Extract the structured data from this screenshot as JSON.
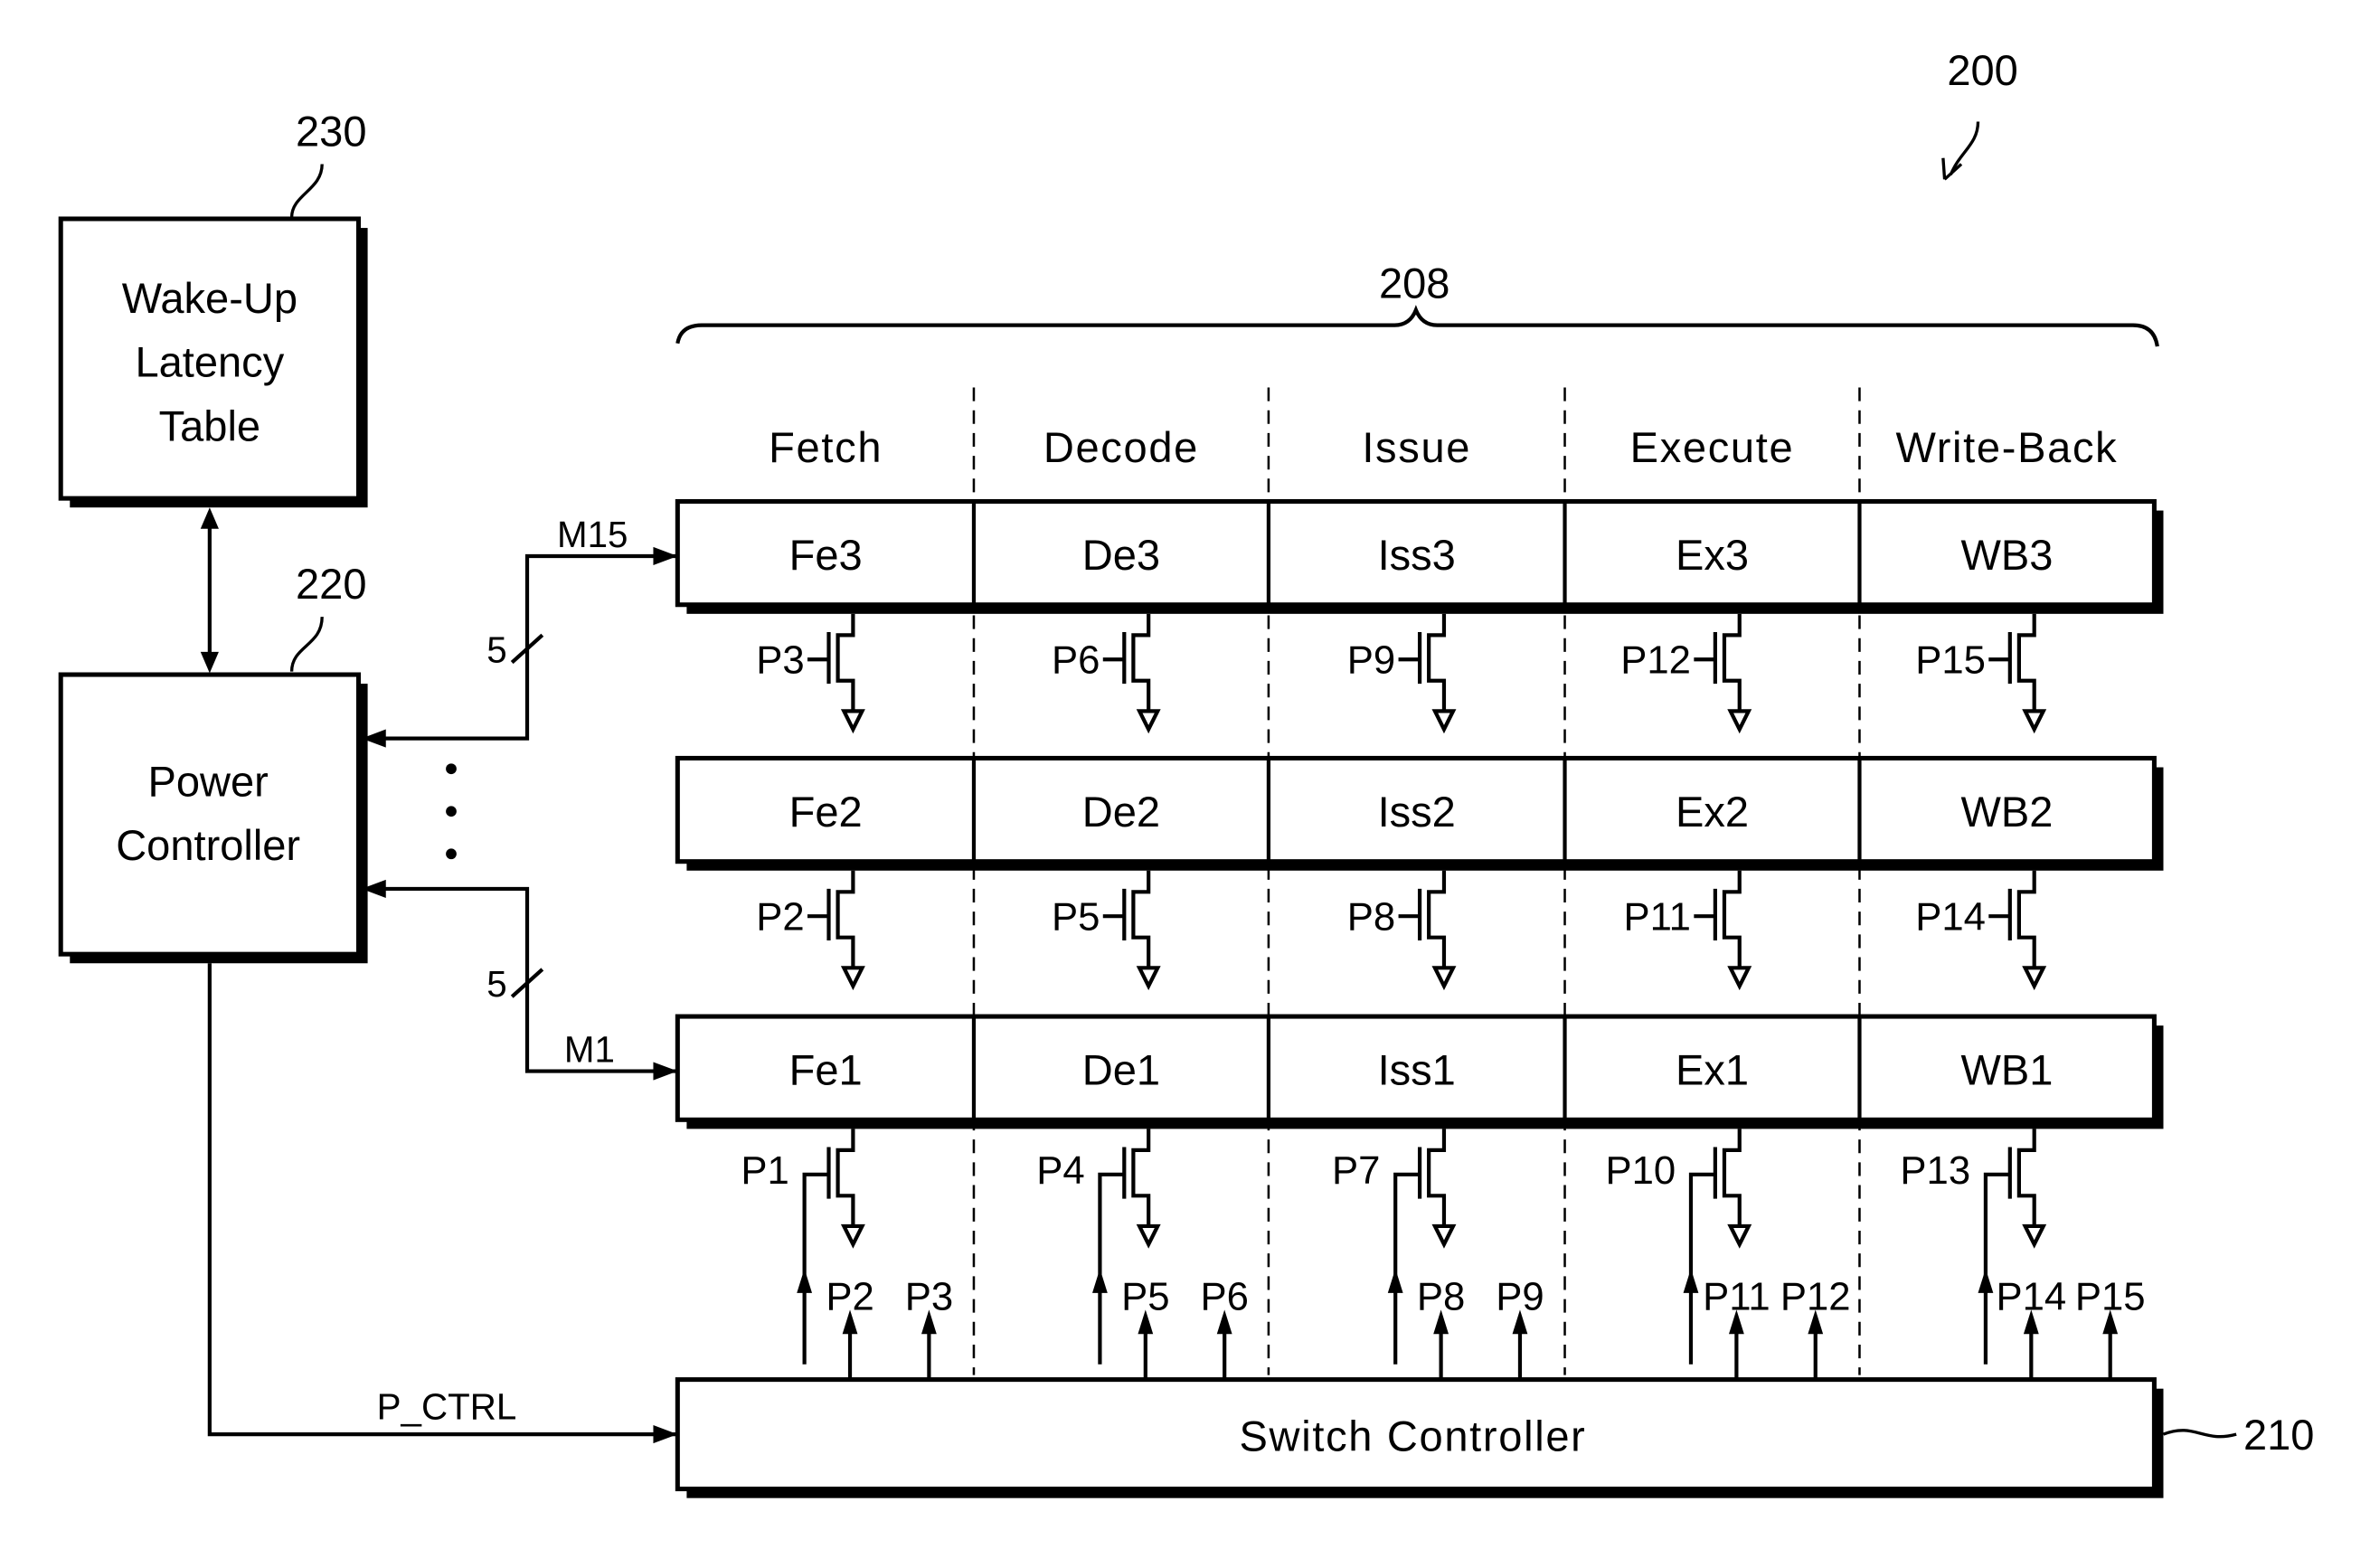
{
  "figure": {
    "ref_system": "200",
    "ref_pipeline": "208",
    "ref_switch_controller": "210",
    "ref_power_controller": "220",
    "ref_latency_table": "230"
  },
  "blocks": {
    "latency_table": [
      "Wake-Up",
      "Latency",
      "Table"
    ],
    "power_controller": [
      "Power",
      "Controller"
    ],
    "switch_controller": "Switch Controller"
  },
  "stages": [
    "Fetch",
    "Decode",
    "Issue",
    "Execute",
    "Write-Back"
  ],
  "pipeline_rows": [
    {
      "id": "row3",
      "cells": [
        "Fe3",
        "De3",
        "Iss3",
        "Ex3",
        "WB3"
      ],
      "gates": [
        "P3",
        "P6",
        "P9",
        "P12",
        "P15"
      ]
    },
    {
      "id": "row2",
      "cells": [
        "Fe2",
        "De2",
        "Iss2",
        "Ex2",
        "WB2"
      ],
      "gates": [
        "P2",
        "P5",
        "P8",
        "P11",
        "P14"
      ]
    },
    {
      "id": "row1",
      "cells": [
        "Fe1",
        "De1",
        "Iss1",
        "Ex1",
        "WB1"
      ],
      "gates": [
        "P1",
        "P4",
        "P7",
        "P10",
        "P13"
      ]
    }
  ],
  "switch_outputs": [
    [
      "P2",
      "P3"
    ],
    [
      "P5",
      "P6"
    ],
    [
      "P8",
      "P9"
    ],
    [
      "P11",
      "P12"
    ],
    [
      "P14",
      "P15"
    ]
  ],
  "signals": {
    "m15": "M15",
    "m1": "M1",
    "bus_width_top": "5",
    "bus_width_bottom": "5",
    "p_ctrl": "P_CTRL"
  }
}
